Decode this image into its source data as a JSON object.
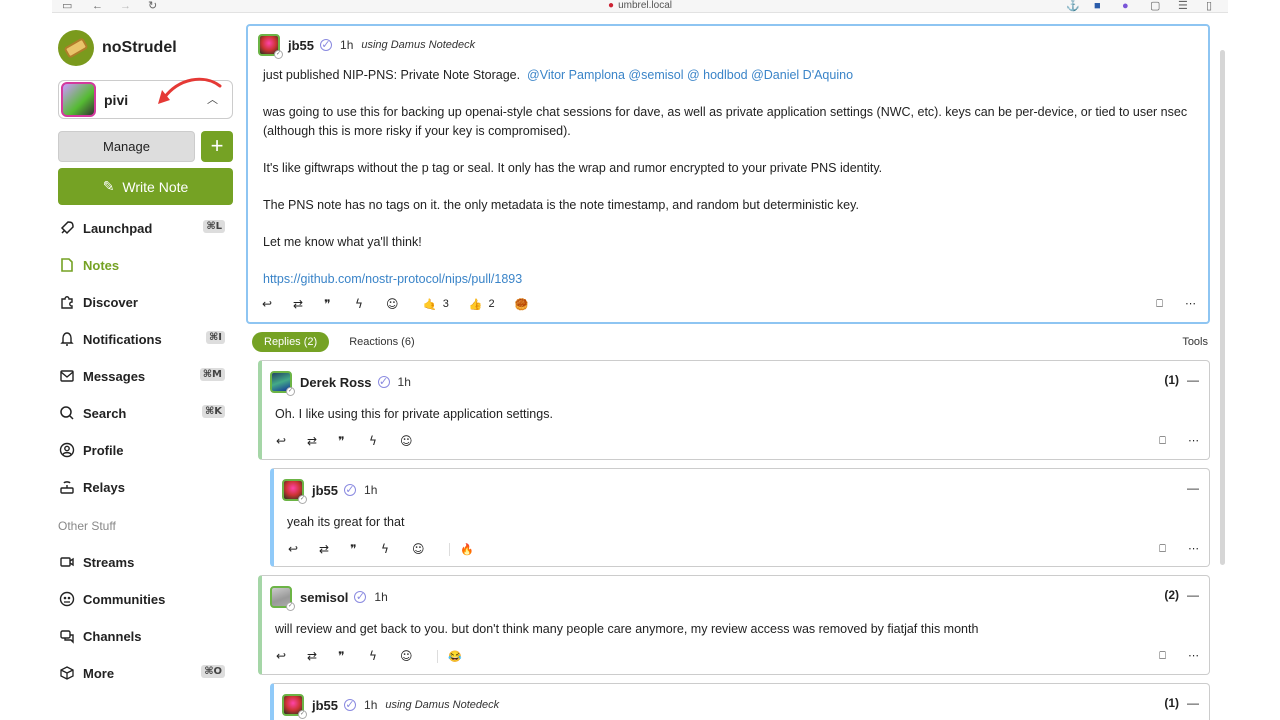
{
  "browser": {
    "url": "umbrel.local"
  },
  "sidebar": {
    "brand": "noStrudel",
    "account": {
      "name": "pivi"
    },
    "manage_label": "Manage",
    "plus_label": "+",
    "write_label": "Write Note",
    "nav": [
      {
        "label": "Launchpad",
        "kbd": "⌘L"
      },
      {
        "label": "Notes",
        "kbd": ""
      },
      {
        "label": "Discover",
        "kbd": ""
      },
      {
        "label": "Notifications",
        "kbd": "⌘I"
      },
      {
        "label": "Messages",
        "kbd": "⌘M"
      },
      {
        "label": "Search",
        "kbd": "⌘K"
      },
      {
        "label": "Profile",
        "kbd": ""
      },
      {
        "label": "Relays",
        "kbd": ""
      }
    ],
    "other_label": "Other Stuff",
    "other": [
      {
        "label": "Streams",
        "kbd": ""
      },
      {
        "label": "Communities",
        "kbd": ""
      },
      {
        "label": "Channels",
        "kbd": ""
      },
      {
        "label": "More",
        "kbd": "⌘O"
      }
    ],
    "accent_color": "#75a224"
  },
  "post": {
    "author": "jb55",
    "ago": "1h",
    "client": "using Damus Notedeck",
    "line1": "just published NIP-PNS: Private Note Storage.",
    "mentions": "@Vitor Pamplona @semisol @ hodlbod @Daniel D'Aquino",
    "p2": "was going to use this for backing up openai-style chat sessions for dave, as well as private application settings (NWC, etc). keys can be per-device, or tied to user nsec (although this is more risky if your key is compromised).",
    "p3": "It's like giftwraps without the p tag or seal. It only has the wrap and rumor encrypted to your private PNS identity.",
    "p4": "The PNS note has no tags on it. the only metadata is the note timestamp, and random but deterministic key.",
    "p5": "Let me know what ya'll think!",
    "link": "https://github.com/nostr-protocol/nips/pull/1893",
    "reaction1_emoji": "🤙",
    "reaction1_count": "3",
    "reaction2_emoji": "👍",
    "reaction2_count": "2",
    "reaction3_emoji": "🥮"
  },
  "tabs": {
    "replies": "Replies (2)",
    "reactions": "Reactions (6)",
    "tools": "Tools"
  },
  "replies": [
    {
      "author": "Derek Ross",
      "ago": "1h",
      "text": "Oh. I like using this for private application settings.",
      "count": "(1)",
      "client": "",
      "reaction": ""
    },
    {
      "author": "jb55",
      "ago": "1h",
      "text": "yeah its great for that",
      "count": "",
      "client": "",
      "reaction": "🔥"
    },
    {
      "author": "semisol",
      "ago": "1h",
      "text": "will review and get back to you. but don't think many people care anymore, my review access was removed by fiatjaf this month",
      "count": "(2)",
      "client": "",
      "reaction": "😂"
    },
    {
      "author": "jb55",
      "ago": "1h",
      "text": "",
      "count": "(1)",
      "client": "using Damus Notedeck",
      "reaction": ""
    }
  ]
}
